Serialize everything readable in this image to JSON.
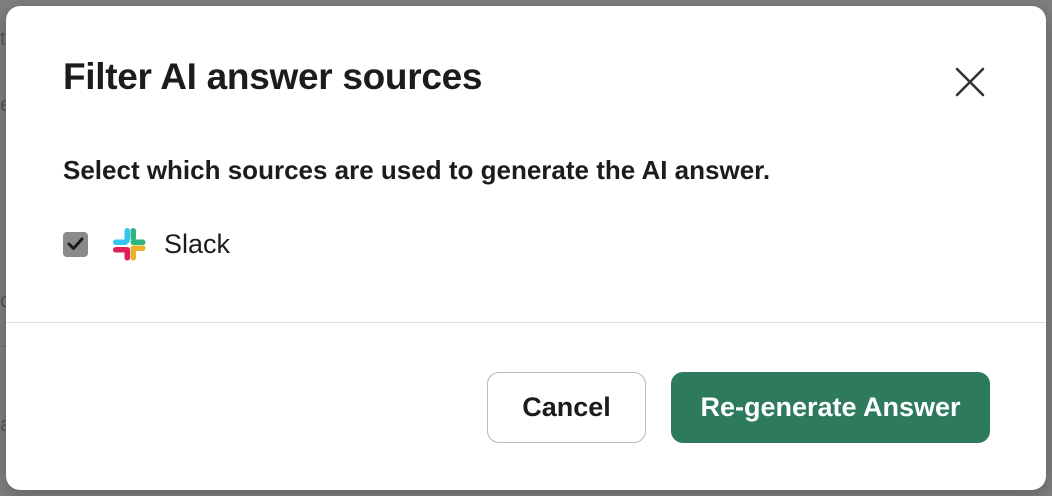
{
  "modal": {
    "title": "Filter AI answer sources",
    "subtitle": "Select which sources are used to generate the AI answer.",
    "close_icon": "close-icon"
  },
  "sources": [
    {
      "label": "Slack",
      "checked": true,
      "icon": "slack-logo-icon"
    }
  ],
  "footer": {
    "cancel_label": "Cancel",
    "primary_label": "Re-generate Answer"
  },
  "colors": {
    "primary": "#2e7a5c",
    "checkbox": "#8a8a8a",
    "text": "#1d1c1d"
  }
}
